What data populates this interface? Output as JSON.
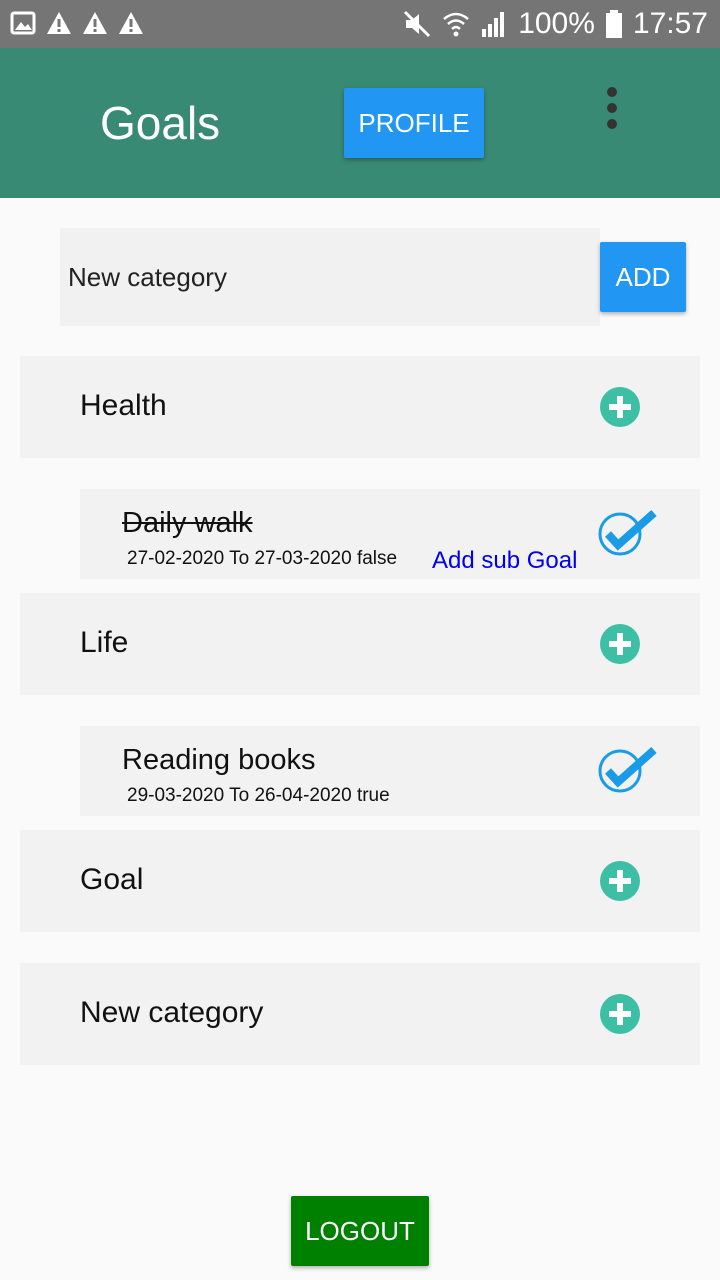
{
  "status_bar": {
    "battery": "100%",
    "time": "17:57",
    "left_icons": [
      "image-icon",
      "warning-icon",
      "warning-icon",
      "warning-icon"
    ],
    "right_icons": [
      "mute-icon",
      "wifi-icon",
      "signal-icon",
      "battery-icon"
    ]
  },
  "app_bar": {
    "title": "Goals",
    "profile_label": "PROFILE",
    "menu_icon": "more-vert-icon",
    "color": "#388a75"
  },
  "new_category": {
    "placeholder": "New category",
    "add_label": "ADD"
  },
  "categories": [
    {
      "label": "Health",
      "goals": [
        {
          "title": "Daily  walk",
          "dates": "27-02-2020 To 27-03-2020 false",
          "sub_goal_link": "Add sub Goal",
          "completed_style": "strikethrough"
        }
      ]
    },
    {
      "label": "Life",
      "goals": [
        {
          "title": "Reading books",
          "dates": "29-03-2020 To 26-04-2020 true"
        }
      ]
    },
    {
      "label": "Goal",
      "goals": []
    },
    {
      "label": "New category",
      "goals": []
    }
  ],
  "logout_label": "LOGOUT",
  "colors": {
    "accent_button": "#2196f3",
    "plus_icon": "#3cbfa5",
    "check_icon": "#1a9be6",
    "logout_button": "#008000",
    "link": "#0000ee"
  }
}
